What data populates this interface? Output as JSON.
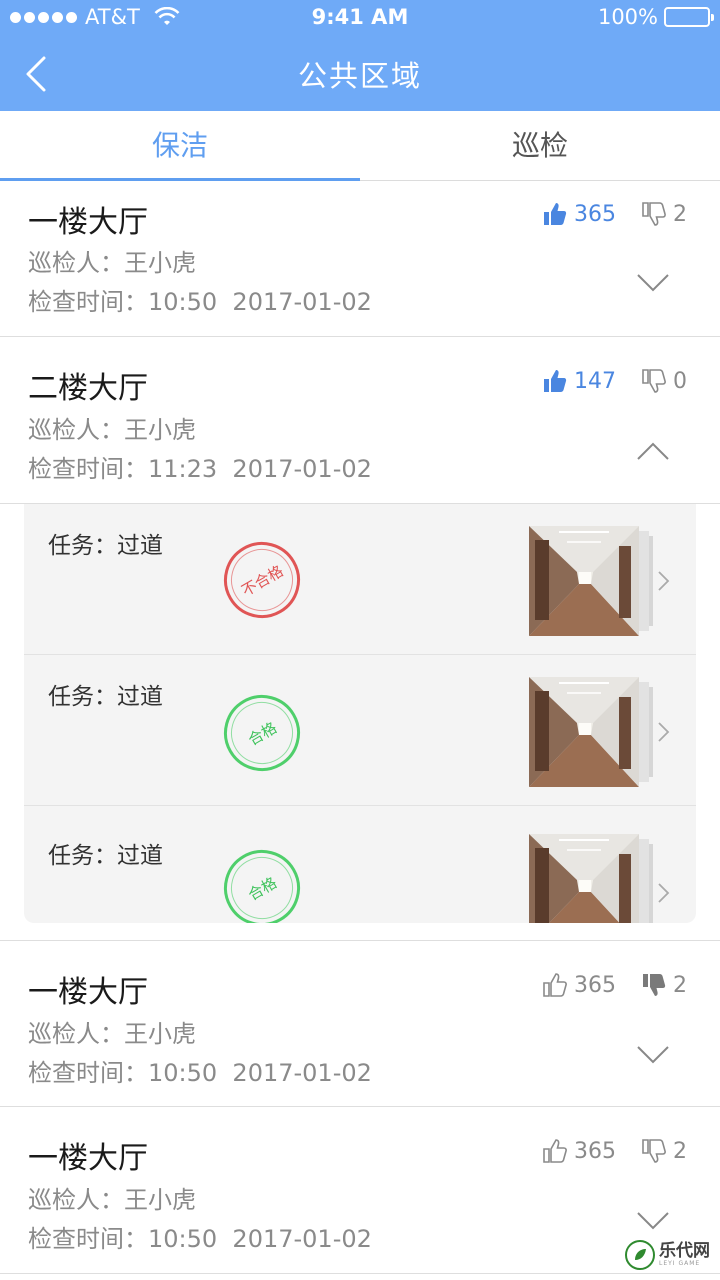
{
  "status_bar": {
    "carrier": "AT&T",
    "time": "9:41 AM",
    "battery": "100%"
  },
  "nav": {
    "title": "公共区域"
  },
  "tabs": [
    {
      "label": "保洁",
      "active": true
    },
    {
      "label": "巡检",
      "active": false
    }
  ],
  "cards": [
    {
      "name": "一楼大厅",
      "inspector": "巡检人：王小虎",
      "check_time": "检查时间：10:50  2017-01-02",
      "likes": "365",
      "dislikes": "2",
      "liked": true,
      "disliked": false,
      "expanded": false
    },
    {
      "name": "二楼大厅",
      "inspector": "巡检人：王小虎",
      "check_time": "检查时间：11:23  2017-01-02",
      "likes": "147",
      "dislikes": "0",
      "liked": true,
      "disliked": false,
      "expanded": true
    },
    {
      "name": "一楼大厅",
      "inspector": "巡检人：王小虎",
      "check_time": "检查时间：10:50  2017-01-02",
      "likes": "365",
      "dislikes": "2",
      "liked": false,
      "disliked": true,
      "expanded": false
    },
    {
      "name": "一楼大厅",
      "inspector": "巡检人：王小虎",
      "check_time": "检查时间：10:50  2017-01-02",
      "likes": "365",
      "dislikes": "2",
      "liked": false,
      "disliked": false,
      "expanded": false
    }
  ],
  "tasks": [
    {
      "label": "任务：过道",
      "result": "不合格",
      "status": "fail"
    },
    {
      "label": "任务：过道",
      "result": "合格",
      "status": "pass"
    },
    {
      "label": "任务：过道",
      "result": "合格",
      "status": "pass"
    }
  ],
  "watermark": {
    "text": "乐代网",
    "sub": "LEYI GAME"
  },
  "colors": {
    "header": "#6faaf7",
    "accent": "#5f9ef0",
    "like_active": "#4a86e0",
    "fail": "#e05555",
    "pass": "#4fcf6b"
  }
}
